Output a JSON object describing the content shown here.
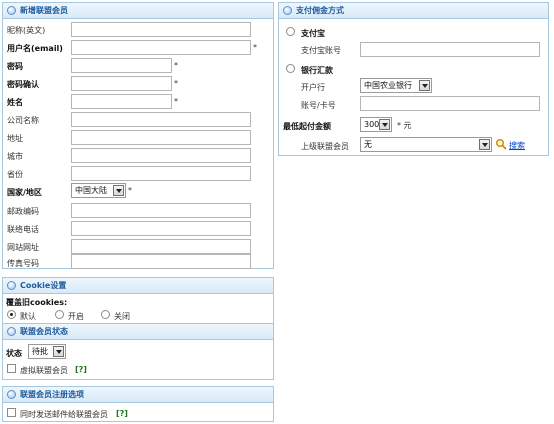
{
  "new_member": {
    "title": "新增联盟会员",
    "fields": [
      {
        "label": "昵称(英文)",
        "bold": false,
        "required": false
      },
      {
        "label": "用户名(email)",
        "bold": true,
        "required": true
      },
      {
        "label": "密码",
        "bold": true,
        "required": true
      },
      {
        "label": "密码确认",
        "bold": true,
        "required": true
      },
      {
        "label": "姓名",
        "bold": true,
        "required": true
      },
      {
        "label": "公司名称",
        "bold": false,
        "required": false
      },
      {
        "label": "地址",
        "bold": false,
        "required": false
      },
      {
        "label": "城市",
        "bold": false,
        "required": false
      },
      {
        "label": "省份",
        "bold": false,
        "required": false
      }
    ],
    "country_label": "国家/地区",
    "country_value": "中国大陆",
    "required_mark": "*",
    "fields2": [
      {
        "label": "邮政编码"
      },
      {
        "label": "联络电话"
      },
      {
        "label": "网站网址"
      },
      {
        "label": "传真号码"
      }
    ]
  },
  "payment": {
    "title": "支付佣金方式",
    "alipay_label": "支付宝",
    "alipay_account_label": "支付宝账号",
    "bank_label": "银行汇款",
    "bank_name_label": "开户行",
    "bank_name_value": "中国农业银行",
    "account_label": "账号/卡号",
    "min_label": "最低起付金额",
    "min_value": "300",
    "min_unit": "* 元",
    "parent_label": "上级联盟会员",
    "parent_value": "无",
    "search_label": "搜索"
  },
  "cookie": {
    "title": "Cookie设置",
    "override_label": "覆盖旧cookies:",
    "options": [
      "默认",
      "开启",
      "关闭"
    ],
    "selected": 0
  },
  "status": {
    "title": "联盟会员状态",
    "status_label": "状态",
    "status_value": "待批",
    "virtual_label": "虚拟联盟会员",
    "help": "[?]"
  },
  "register": {
    "title": "联盟会员注册选项",
    "email_label": "同时发送邮件给联盟会员",
    "help": "[?]"
  }
}
